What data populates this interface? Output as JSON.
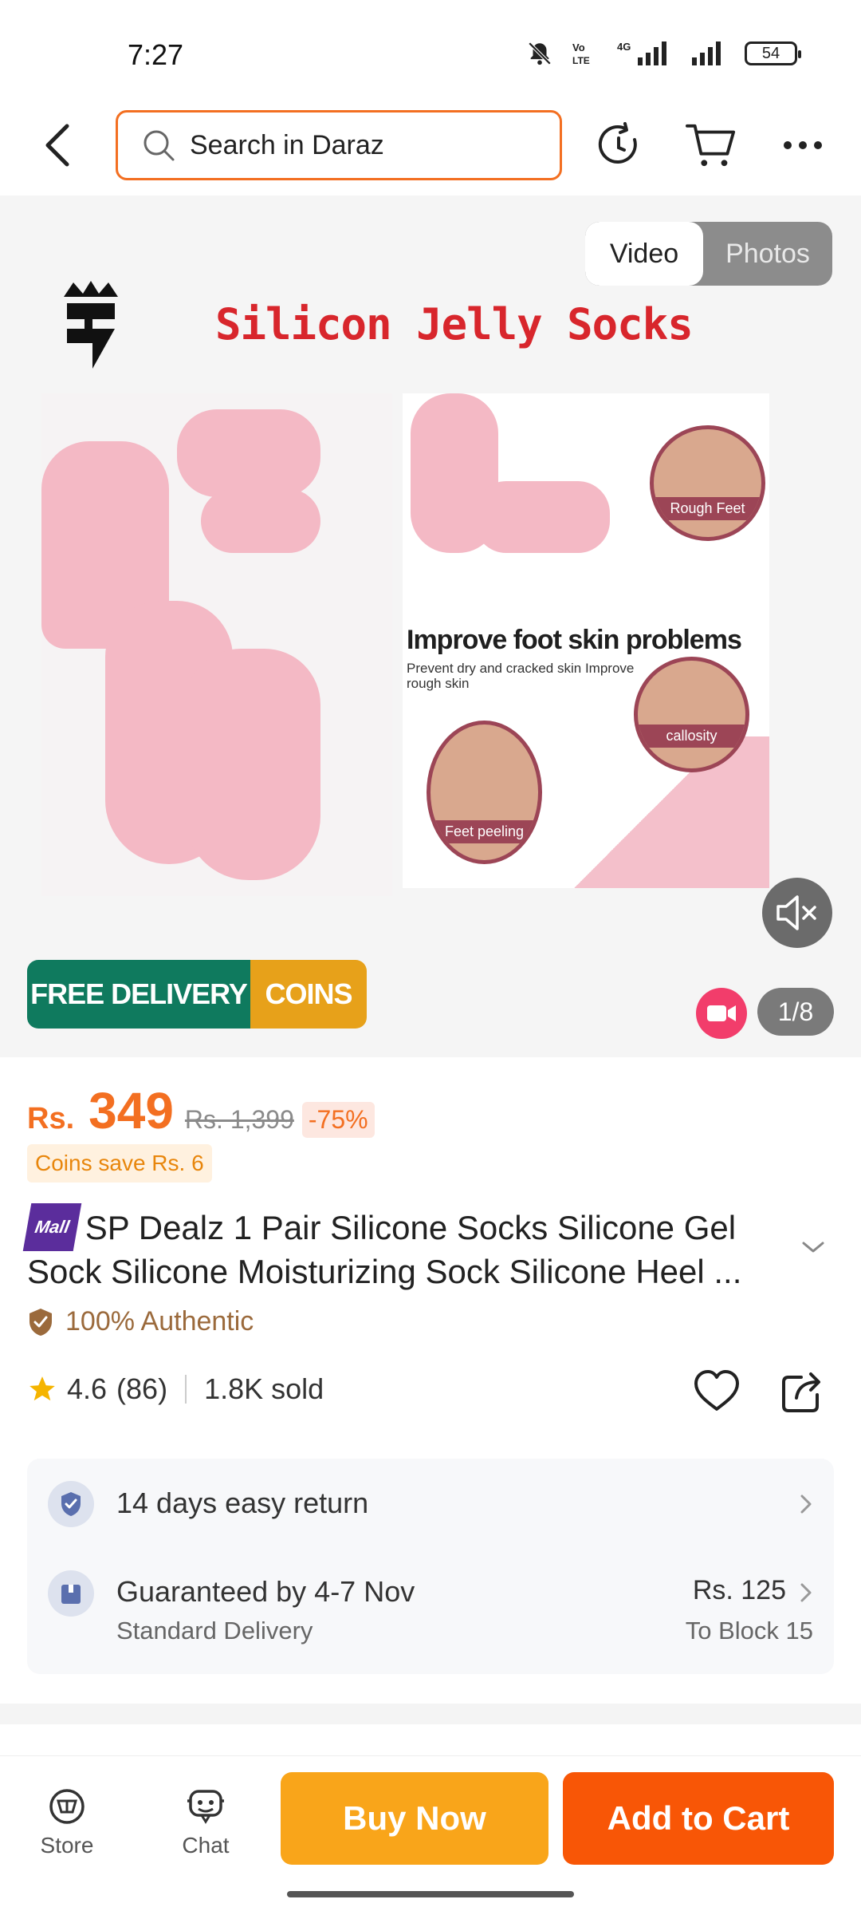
{
  "status_bar": {
    "time": "7:27",
    "battery": "54"
  },
  "search": {
    "placeholder": "Search in Daraz"
  },
  "media": {
    "toggle_video": "Video",
    "toggle_photos": "Photos",
    "image_title": "Silicon Jelly Socks",
    "improve_heading": "Improve foot skin problems",
    "improve_sub": "Prevent dry and cracked skin Improve rough skin",
    "circle_labels": [
      "Rough Feet",
      "callosity",
      "Feet peeling"
    ],
    "page_counter": "1/8",
    "badge_free_delivery": "FREE DELIVERY",
    "badge_coins": "COINS"
  },
  "price": {
    "currency": "Rs.",
    "current": "349",
    "original": "Rs. 1,399",
    "discount": "-75%",
    "coins_save": "Coins save Rs. 6"
  },
  "product": {
    "mall_badge": "Mall",
    "title": "SP Dealz 1 Pair Silicone Socks Silicone Gel Sock Silicone Moisturizing Sock Silicone Heel ...",
    "authentic": "100% Authentic",
    "rating": "4.6",
    "reviews": "(86)",
    "sold": "1.8K sold"
  },
  "info": {
    "return_text": "14 days easy return",
    "delivery_main": "Guaranteed by 4-7 Nov",
    "delivery_sub": "Standard Delivery",
    "delivery_price": "Rs. 125",
    "delivery_location": "To Block 15"
  },
  "bottom_bar": {
    "store_label": "Store",
    "chat_label": "Chat",
    "buy_now": "Buy Now",
    "add_to_cart": "Add to Cart"
  },
  "colors": {
    "accent": "#f85606",
    "price": "#f36f21",
    "buy_now": "#f9a51a",
    "free_delivery": "#0f7a5e",
    "coins": "#e7a11a"
  }
}
